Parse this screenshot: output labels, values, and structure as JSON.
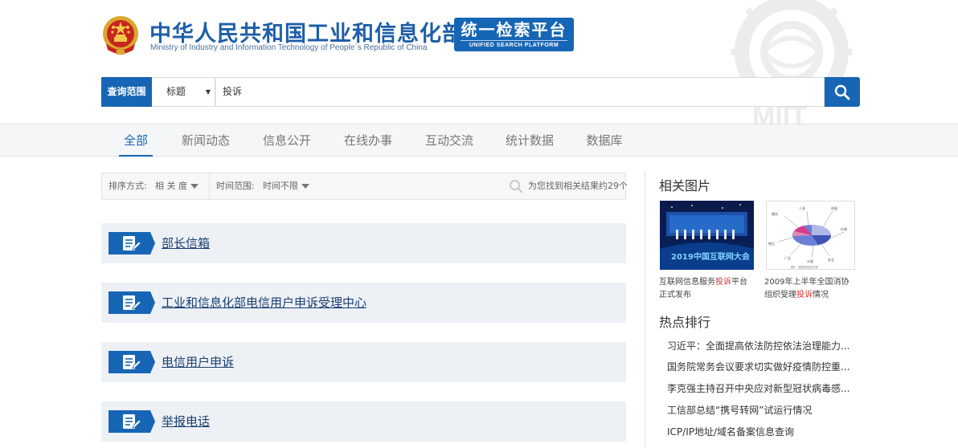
{
  "header": {
    "title": "中华人民共和国工业和信息化部",
    "subtitle": "Ministry of Industry and Information Technology of People`s Republic of China",
    "platform_title": "统一检索平台",
    "platform_subtitle": "UNIFIED SEARCH PLATFORM",
    "watermark_text": "MIIT"
  },
  "search": {
    "scope_label": "查询范围",
    "scope_value": "标题",
    "query": "投诉"
  },
  "nav": {
    "tabs": [
      {
        "label": "全部",
        "active": true
      },
      {
        "label": "新闻动态",
        "active": false
      },
      {
        "label": "信息公开",
        "active": false
      },
      {
        "label": "在线办事",
        "active": false
      },
      {
        "label": "互动交流",
        "active": false
      },
      {
        "label": "统计数据",
        "active": false
      },
      {
        "label": "数据库",
        "active": false
      }
    ]
  },
  "filters": {
    "sort_label": "排序方式:",
    "sort_value": "相 关 度",
    "time_label": "时间范围:",
    "time_value": "时间不限",
    "result_count": "为您找到相关结果约29个"
  },
  "results": [
    {
      "title": "部长信箱"
    },
    {
      "title": "工业和信息化部电信用户申诉受理中心"
    },
    {
      "title": "电信用户申诉"
    },
    {
      "title": "举报电话"
    }
  ],
  "sidebar": {
    "images_heading": "相关图片",
    "images": [
      {
        "caption_before": "互联网信息服务",
        "caption_highlight": "投诉",
        "caption_after": "平台正式发布"
      },
      {
        "caption_before": "2009年上半年全国消协组织受理",
        "caption_highlight": "投诉",
        "caption_after": "情况"
      }
    ],
    "hot_heading": "热点排行",
    "hot_items": [
      "习近平：全面提高依法防控依法治理能力...",
      "国务院常务会议要求切实做好疫情防控重...",
      "李克强主持召开中央应对新型冠状病毒感...",
      "工信部总结“携号转网”试运行情况",
      "ICP/IP地址/域名备案信息查询"
    ]
  },
  "colors": {
    "brand_blue": "#1766b5",
    "nav_bg": "#f5f6f8",
    "result_bg": "#edf1f6",
    "highlight_red": "#d43030"
  }
}
